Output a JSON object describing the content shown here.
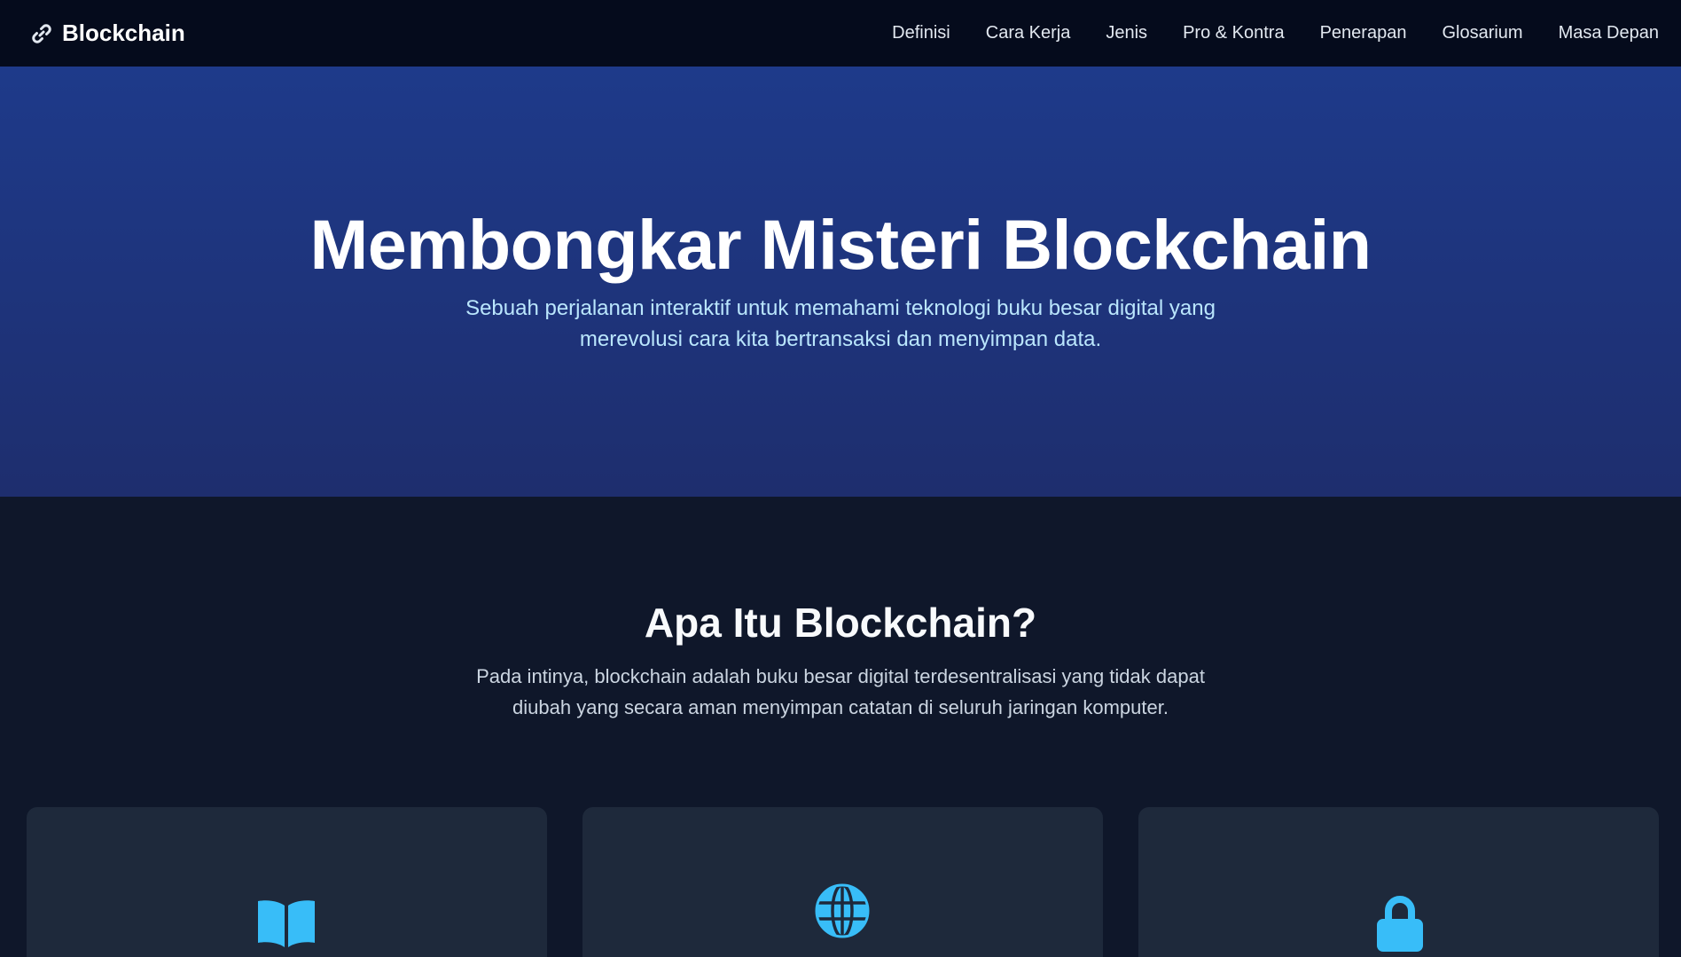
{
  "navbar": {
    "brand_icon": "link-icon",
    "brand_name": "Blockchain",
    "links": [
      "Definisi",
      "Cara Kerja",
      "Jenis",
      "Pro & Kontra",
      "Penerapan",
      "Glosarium",
      "Masa Depan"
    ]
  },
  "hero": {
    "title": "Membongkar Misteri Blockchain",
    "subtitle": "Sebuah perjalanan interaktif untuk memahami teknologi buku besar digital yang merevolusi cara kita bertransaksi dan menyimpan data."
  },
  "definition": {
    "title": "Apa Itu Blockchain?",
    "description": "Pada intinya, blockchain adalah buku besar digital terdesentralisasi yang tidak dapat diubah yang secara aman menyimpan catatan di seluruh jaringan komputer.",
    "cards": [
      {
        "icon": "book-icon"
      },
      {
        "icon": "globe-icon"
      },
      {
        "icon": "lock-icon"
      }
    ]
  },
  "colors": {
    "navbar_bg": "#050b1c",
    "hero_gradient_top": "#1e3a8a",
    "page_bg": "#0f172a",
    "card_bg": "#1e293b",
    "accent": "#38bdf8",
    "subtitle_text": "#bae6fd"
  }
}
